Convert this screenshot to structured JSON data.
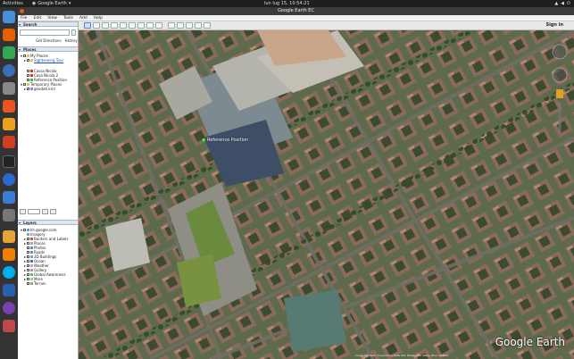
{
  "topbar": {
    "activities": "Activities",
    "app_name": "Google Earth",
    "clock": "lun lug 15, 10:54:21"
  },
  "window": {
    "title": "Google Earth EC",
    "menu": [
      "File",
      "Edit",
      "View",
      "Tools",
      "Add",
      "Help"
    ],
    "sign_in": "Sign in"
  },
  "sidebar": {
    "search": {
      "header": "Search",
      "placeholder": "",
      "get_directions": "Get Directions",
      "history": "History"
    },
    "places": {
      "header": "Places",
      "items": [
        {
          "label": "My Places",
          "indent": 1
        },
        {
          "label": "Sightseeing Tour",
          "indent": 2,
          "link": true
        },
        {
          "label": "Cassa Nicola",
          "indent": 2
        },
        {
          "label": "Casa Nicola 2",
          "indent": 2
        },
        {
          "label": "Reference Position",
          "indent": 2
        },
        {
          "label": "Temporary Places",
          "indent": 1
        },
        {
          "label": "geodati.kml",
          "indent": 2
        }
      ]
    },
    "layers": {
      "header": "Layers",
      "items": [
        {
          "label": "kh.google.com",
          "indent": 1
        },
        {
          "label": "Imagery",
          "indent": 2
        },
        {
          "label": "Borders and Labels",
          "indent": 2
        },
        {
          "label": "Places",
          "indent": 2
        },
        {
          "label": "Photos",
          "indent": 2
        },
        {
          "label": "Roads",
          "indent": 2
        },
        {
          "label": "3D Buildings",
          "indent": 2
        },
        {
          "label": "Ocean",
          "indent": 2
        },
        {
          "label": "Weather",
          "indent": 2
        },
        {
          "label": "Gallery",
          "indent": 2
        },
        {
          "label": "Global Awareness",
          "indent": 2
        },
        {
          "label": "More",
          "indent": 2
        },
        {
          "label": "Terrain",
          "indent": 2
        }
      ]
    }
  },
  "map": {
    "reference_label": "Reference Position",
    "brand": "Google Earth",
    "footer": "Image Landsat / Copernicus     Data SIO, NOAA, U.S. Navy, NGA, GEBCO"
  },
  "colors": {
    "accent": "#e95420",
    "marker": "#ff2a2a",
    "panel_header": "#dfe6f1"
  }
}
